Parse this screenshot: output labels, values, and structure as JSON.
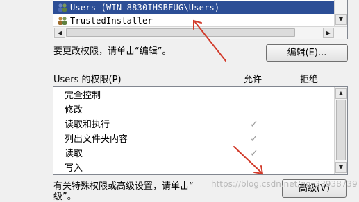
{
  "users": [
    {
      "name": "Users (WIN-8830IHSBFUG\\Users)",
      "selected": true,
      "icon": "users-group-icon"
    },
    {
      "name": "TrustedInstaller",
      "selected": false,
      "icon": "user-group-icon"
    }
  ],
  "edit_hint": "要更改权限，请单击“编辑”。",
  "edit_button": "编辑(E)...",
  "perm_header": {
    "title": "Users 的权限(P)",
    "allow": "允许",
    "deny": "拒绝"
  },
  "permissions": [
    {
      "name": "完全控制",
      "allow": false
    },
    {
      "name": "修改",
      "allow": false
    },
    {
      "name": "读取和执行",
      "allow": true
    },
    {
      "name": "列出文件夹内容",
      "allow": true
    },
    {
      "name": "读取",
      "allow": true
    },
    {
      "name": "写入",
      "allow": false
    }
  ],
  "special_hint_line1": "有关特殊权限或高级设置，请单击“",
  "special_hint_line2": "级”。",
  "advanced_button": "高级(V)",
  "watermark": "https://blog.csdn.net/qq_33938739",
  "colors": {
    "selection": "#2c4e96",
    "arrow": "#d23a2a",
    "check": "#9a9a9a"
  }
}
